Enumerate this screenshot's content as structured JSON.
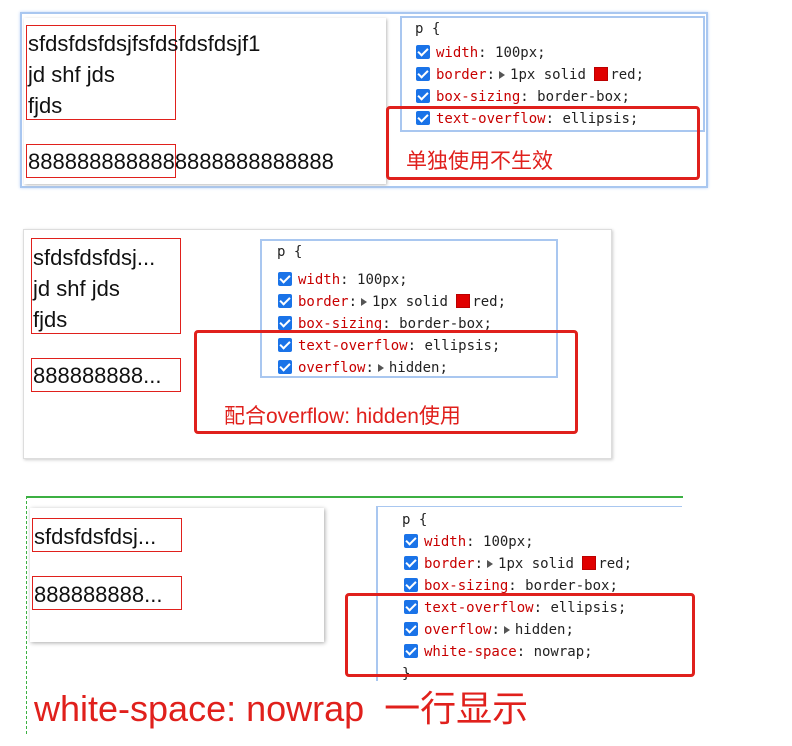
{
  "section1": {
    "demo_p1_lines": [
      "sfdsfdsfdsjfsfdsfdsfdsjf1",
      "jd shf jds",
      "fjds"
    ],
    "demo_p2_text": "8888888888888888888888888",
    "css": {
      "selector": "p {",
      "props": [
        {
          "name": "width",
          "value": "100px;",
          "arrow": false,
          "swatch": false
        },
        {
          "name": "border",
          "value": "1px solid ",
          "arrow": true,
          "swatch": true,
          "value_after": "red;"
        },
        {
          "name": "box-sizing",
          "value": "border-box;",
          "arrow": false,
          "swatch": false
        },
        {
          "name": "text-overflow",
          "value": "ellipsis;",
          "arrow": false,
          "swatch": false
        }
      ]
    },
    "note": "单独使用不生效"
  },
  "section2": {
    "demo_p1_lines": [
      "sfdsfdsfdsj...",
      "jd shf jds",
      "fjds"
    ],
    "demo_p2_text": "888888888...",
    "css": {
      "selector": "p {",
      "props": [
        {
          "name": "width",
          "value": "100px;"
        },
        {
          "name": "border",
          "value": "1px solid ",
          "value_after": "red;"
        },
        {
          "name": "box-sizing",
          "value": "border-box;"
        },
        {
          "name": "text-overflow",
          "value": "ellipsis;"
        },
        {
          "name": "overflow",
          "value": "hidden;"
        }
      ]
    },
    "note": "配合overflow: hidden使用"
  },
  "section3": {
    "demo_p1_text": "sfdsfdsfdsj...",
    "demo_p2_text": "888888888...",
    "css": {
      "selector": "p {",
      "props": [
        {
          "name": "width",
          "value": "100px;"
        },
        {
          "name": "border",
          "value": "1px solid ",
          "value_after": "red;"
        },
        {
          "name": "box-sizing",
          "value": "border-box;"
        },
        {
          "name": "text-overflow",
          "value": "ellipsis;"
        },
        {
          "name": "overflow",
          "value": "hidden;"
        },
        {
          "name": "white-space",
          "value": "nowrap;"
        }
      ],
      "closing": "}"
    },
    "note": "white-space: nowrap  一行显示"
  },
  "colors": {
    "accent_red": "#e0201c",
    "checkbox_blue": "#1a73e8",
    "swatch_red": "#e00000"
  }
}
